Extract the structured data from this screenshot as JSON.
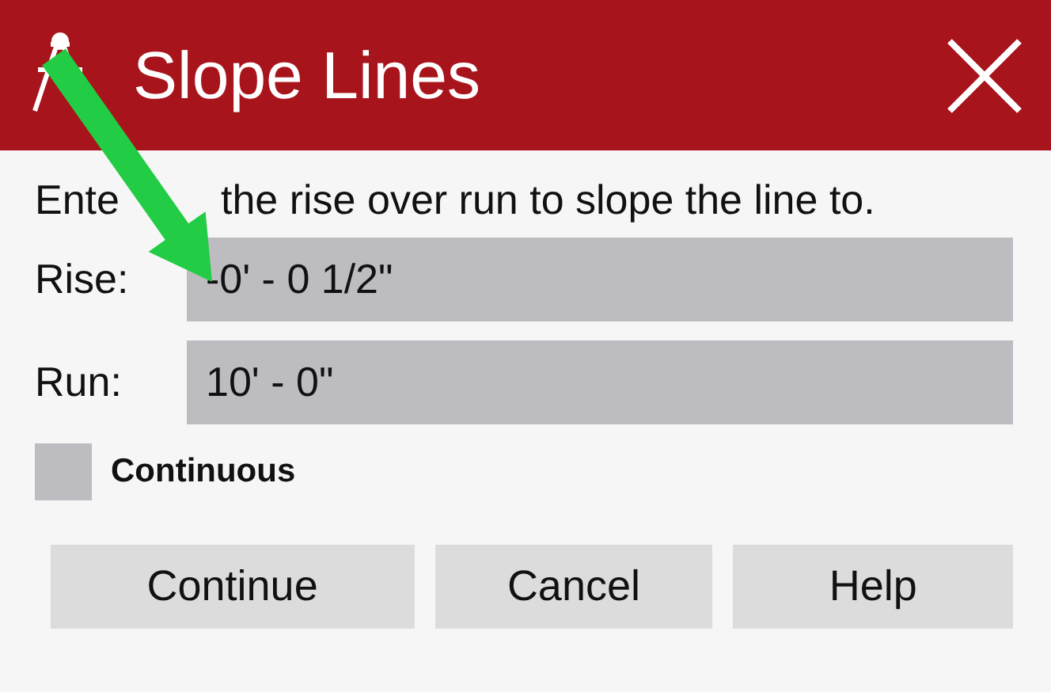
{
  "window": {
    "title": "Slope Lines"
  },
  "instruction": [
    "Ente",
    "the rise over run to slope the line to."
  ],
  "fields": [
    {
      "label": "Rise:",
      "value": "-0' - 0 1/2\""
    },
    {
      "label": "Run:",
      "value": "10' - 0\""
    }
  ],
  "continuous": {
    "label": "Continuous",
    "checked": false
  },
  "buttons": [
    "Continue",
    "Cancel",
    "Help"
  ]
}
